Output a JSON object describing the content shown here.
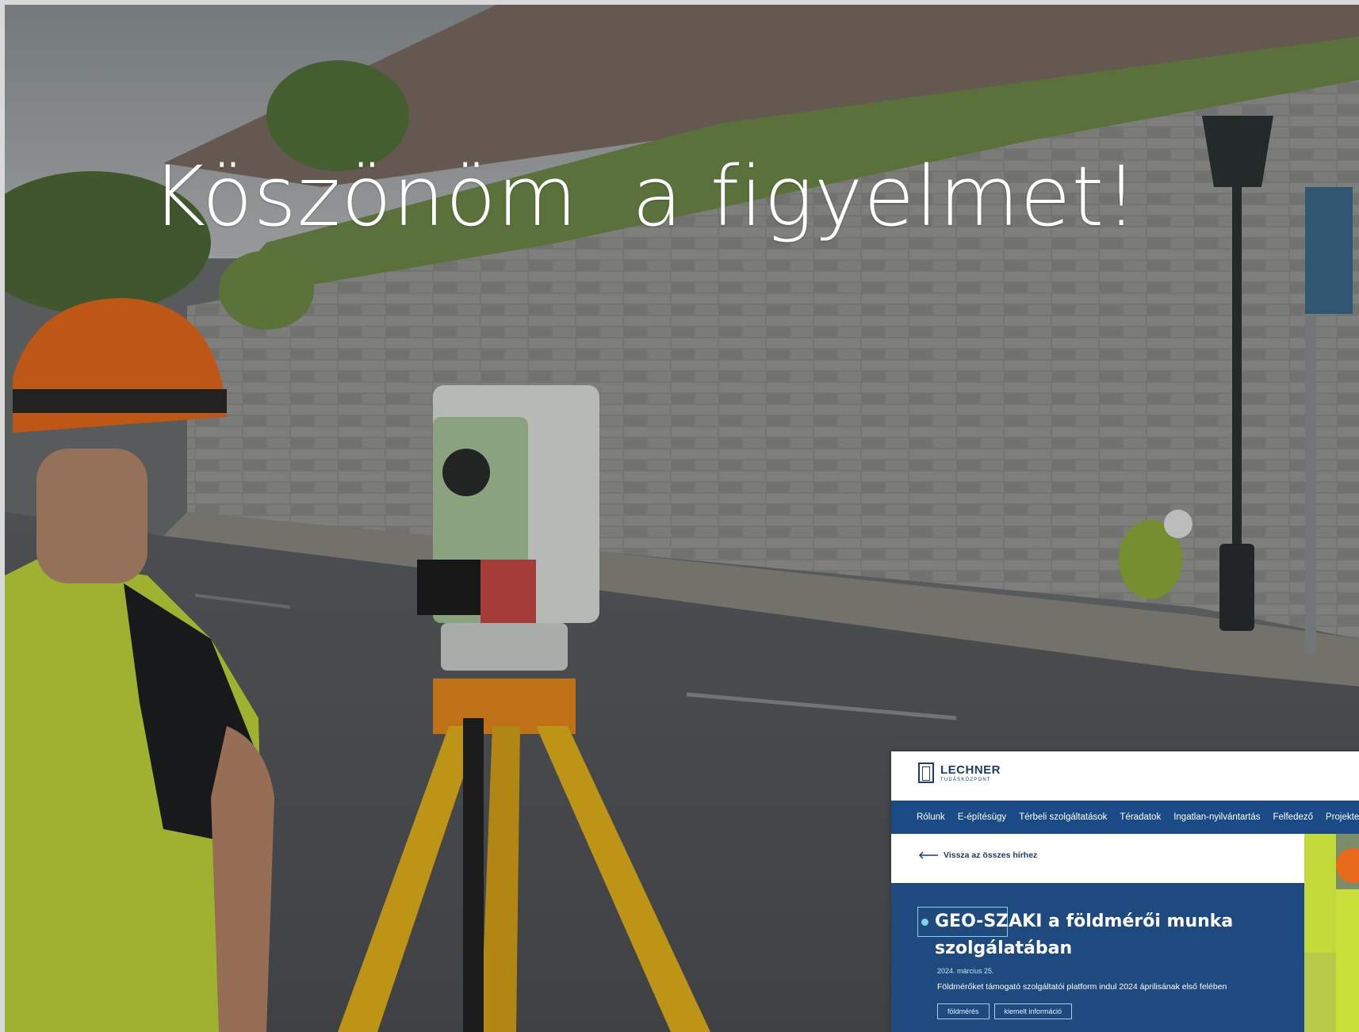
{
  "slide": {
    "title": "Köszönöm  a figyelmet!"
  },
  "inset": {
    "logo": {
      "name": "LECHNER",
      "subtitle": "TUDÁSKÖZPONT"
    },
    "nav": {
      "items": [
        "Rólunk",
        "E-építésügy",
        "Térbeli szolgáltatások",
        "Téradatok",
        "Ingatlan-nyilvántartás",
        "Felfedező",
        "Projektek"
      ]
    },
    "back_link": "Vissza az összes hírhez",
    "article": {
      "title": "GEO-SZAKI a földmérői munka szolgálatában",
      "date": "2024. március 25.",
      "description": "Földmérőket támogató szolgáltatói platform indul 2024 áprilisának első felében",
      "tags": [
        "földmérés",
        "kiemelt információ"
      ]
    }
  },
  "colors": {
    "nav_blue": "#1b4b86",
    "hero_blue": "#1e4a80",
    "logo_navy": "#1d3c66",
    "accent_cyan": "#7fd3e6",
    "helmet_orange": "#e86a1c",
    "vest_yellow": "#c9e03a",
    "tripod_yellow": "#e8b51c",
    "instrument_green": "#a9c79a"
  }
}
